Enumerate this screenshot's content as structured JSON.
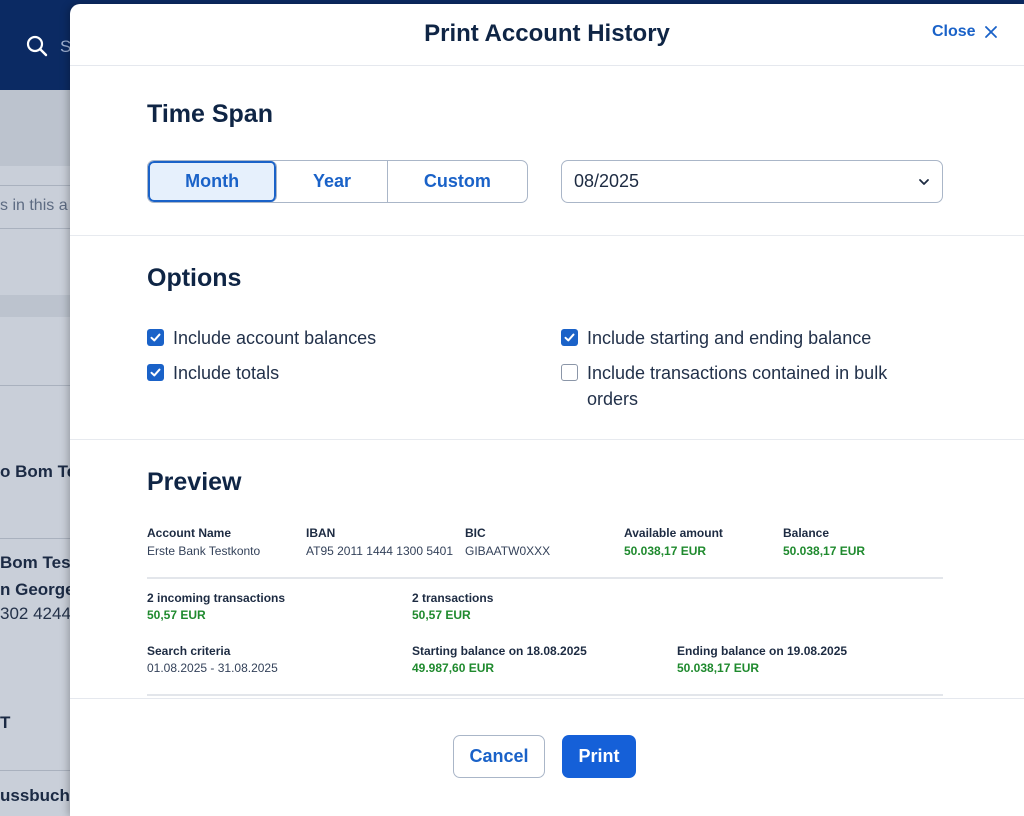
{
  "background": {
    "search_placeholder": "S",
    "hint_text": "s in this a",
    "rows": [
      "o Bom Te",
      "Bom Test",
      "n George",
      "302 4244",
      "T",
      "ussbuch"
    ]
  },
  "modal": {
    "title": "Print Account History",
    "close_label": "Close",
    "time_span": {
      "title": "Time Span",
      "segments": [
        "Month",
        "Year",
        "Custom"
      ],
      "active_segment": "Month",
      "selected_period": "08/2025"
    },
    "options": {
      "title": "Options",
      "items": [
        {
          "label": "Include account balances",
          "checked": true
        },
        {
          "label": "Include totals",
          "checked": true
        },
        {
          "label": "Include starting and ending balance",
          "checked": true
        },
        {
          "label": "Include transactions contained in bulk orders",
          "checked": false
        }
      ]
    },
    "preview": {
      "title": "Preview",
      "account_name_label": "Account Name",
      "account_name": "Erste Bank Testkonto",
      "iban_label": "IBAN",
      "iban": "AT95 2011 1444 1300 5401",
      "bic_label": "BIC",
      "bic": "GIBAATW0XXX",
      "available_label": "Available amount",
      "available": "50.038,17 EUR",
      "balance_label": "Balance",
      "balance": "50.038,17 EUR",
      "incoming_label": "2 incoming transactions",
      "incoming": "50,57 EUR",
      "transactions_label": "2 transactions",
      "transactions": "50,57 EUR",
      "criteria_label": "Search criteria",
      "criteria": "01.08.2025 - 31.08.2025",
      "starting_label": "Starting balance on 18.08.2025",
      "starting": "49.987,60 EUR",
      "ending_label": "Ending balance on 19.08.2025",
      "ending": "50.038,17 EUR"
    },
    "footer": {
      "cancel_label": "Cancel",
      "print_label": "Print"
    }
  },
  "colors": {
    "accent": "#1a62c8",
    "positive": "#1f8a2e",
    "title": "#0f2545"
  }
}
